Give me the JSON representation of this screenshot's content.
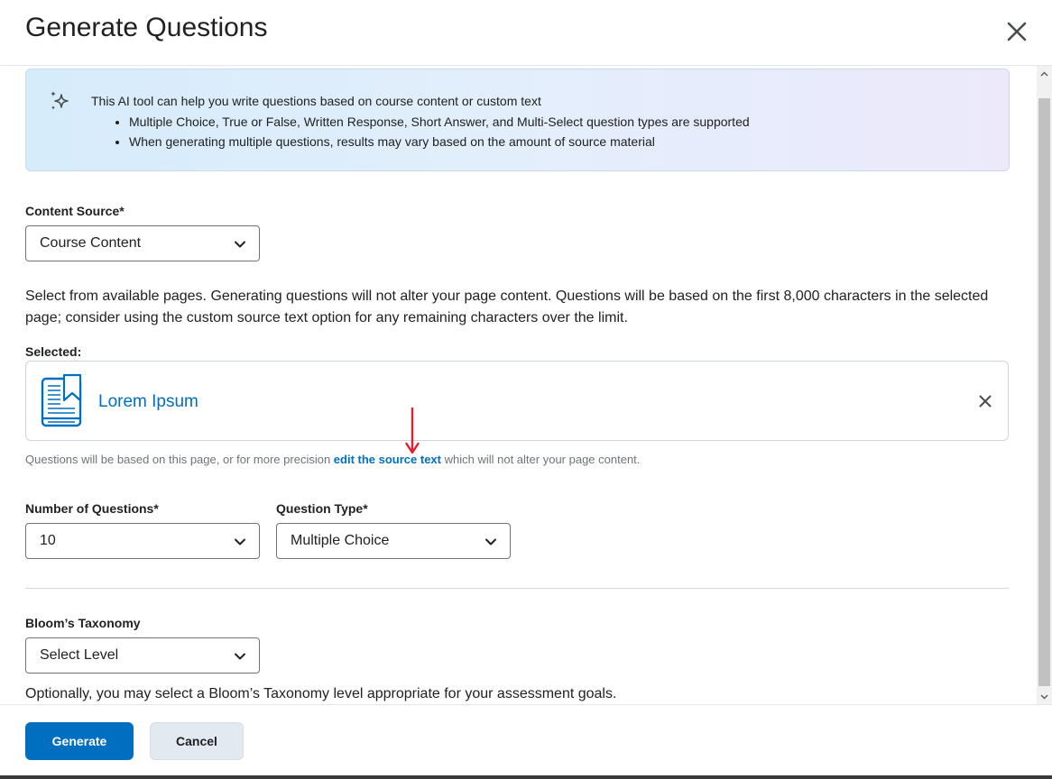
{
  "dialog": {
    "title": "Generate Questions",
    "close_icon": "close-icon"
  },
  "info": {
    "icon": "sparkle-icon",
    "intro": "This AI tool can help you write questions based on course content or custom text",
    "bullets": [
      "Multiple Choice, True or False, Written Response, Short Answer, and Multi-Select question types are supported",
      "When generating multiple questions, results may vary based on the amount of source material"
    ]
  },
  "content_source": {
    "label": "Content Source*",
    "value": "Course Content"
  },
  "description": "Select from available pages. Generating questions will not alter your page content. Questions will be based on the first 8,000 characters in the selected page; consider using the custom source text option for any remaining characters over the limit.",
  "selected": {
    "label": "Selected:",
    "item_title": "Lorem Ipsum",
    "item_icon": "book-icon",
    "remove_icon": "close-icon"
  },
  "helper": {
    "before": "Questions will be based on this page, or for more precision ",
    "link": "edit the source text",
    "after": " which will not alter your page content."
  },
  "num_questions": {
    "label": "Number of Questions*",
    "value": "10"
  },
  "question_type": {
    "label": "Question Type*",
    "value": "Multiple Choice"
  },
  "blooms": {
    "label": "Bloom’s Taxonomy",
    "value": "Select Level",
    "help": "Optionally, you may select a Bloom’s Taxonomy level appropriate for your assessment goals."
  },
  "footer": {
    "generate_label": "Generate",
    "cancel_label": "Cancel"
  },
  "colors": {
    "primary": "#006fbf",
    "annotation_arrow": "#e0202e"
  }
}
